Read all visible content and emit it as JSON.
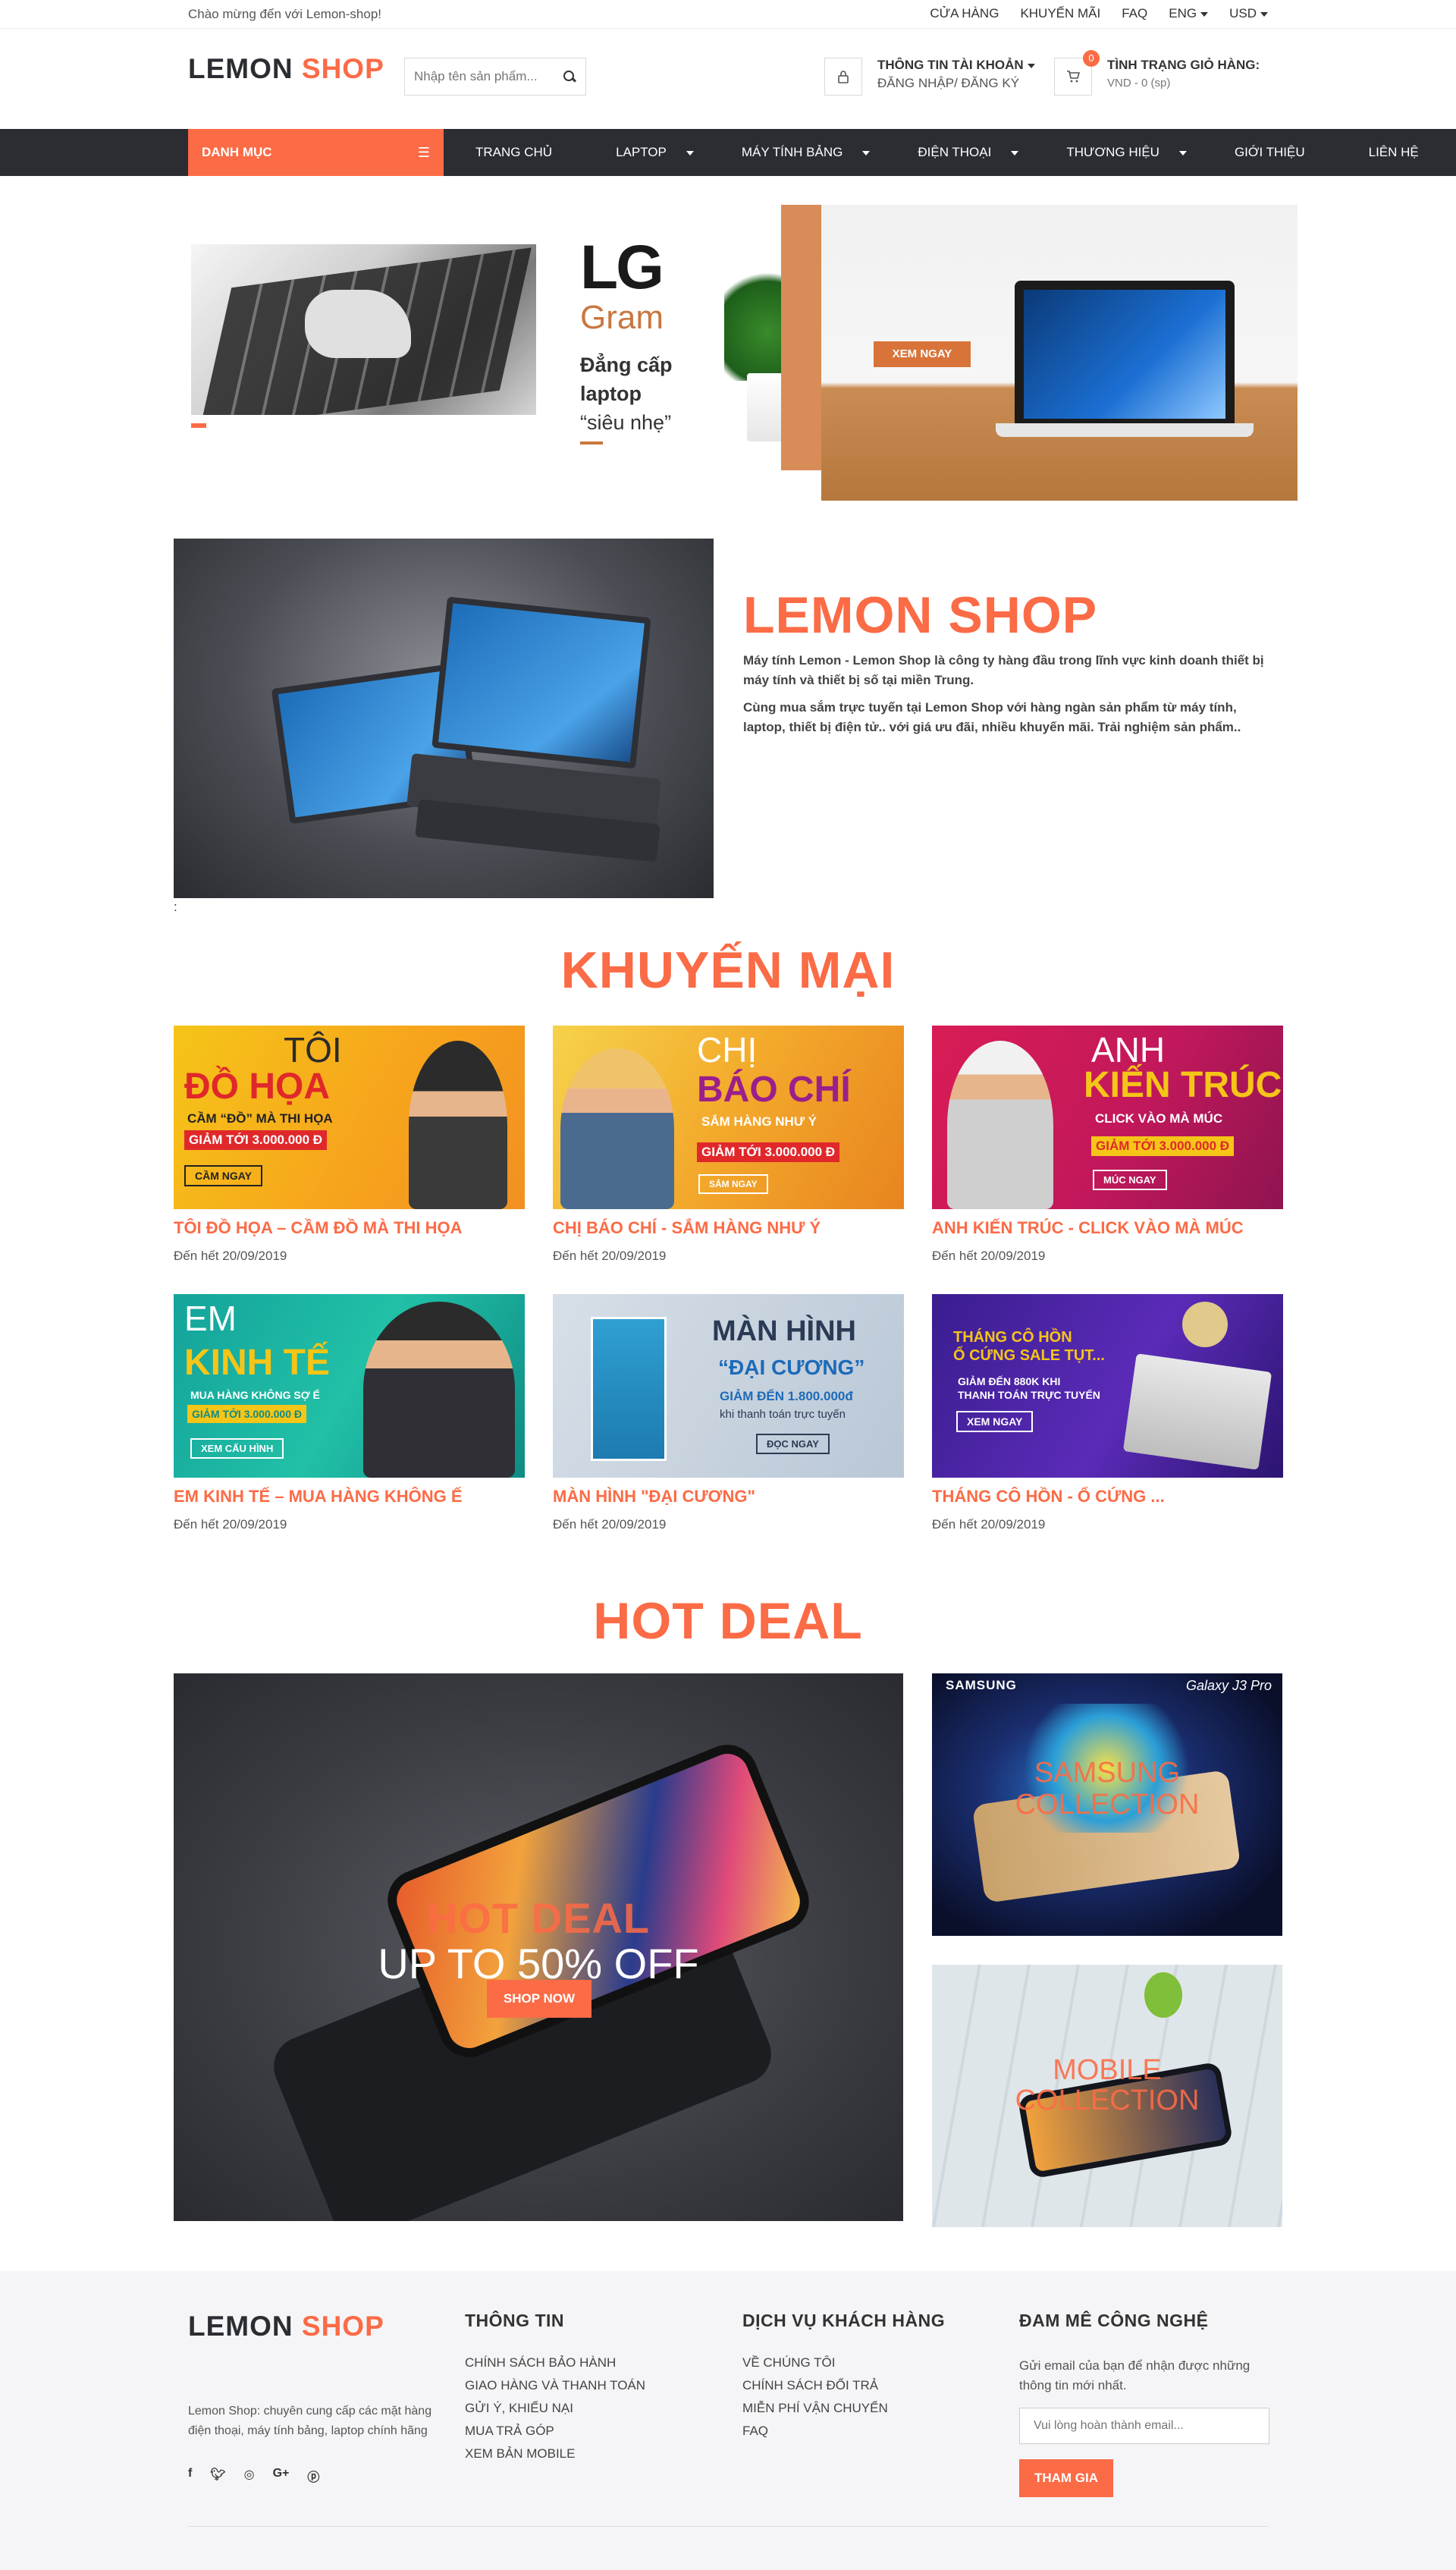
{
  "topbar": {
    "welcome": "Chào mừng đến với Lemon-shop!",
    "links": [
      "CỬA HÀNG",
      "KHUYẾN MÃI",
      "FAQ"
    ],
    "language": "ENG",
    "currency": "USD"
  },
  "header": {
    "logo_part1": "LEMON",
    "logo_part2": "SHOP",
    "search_placeholder": "Nhập tên sản phẩm...",
    "account_title": "THÔNG TIN TÀI KHOẢN",
    "account_sub": "ĐĂNG NHẬP/ ĐĂNG KÝ",
    "cart_title": "TÌNH TRẠNG GIỎ HÀNG:",
    "cart_sub": "VND - 0 (sp)",
    "cart_count": "0"
  },
  "nav": {
    "category_label": "DANH MỤC",
    "items": [
      {
        "label": "TRANG CHỦ",
        "dropdown": false
      },
      {
        "label": "LAPTOP",
        "dropdown": true
      },
      {
        "label": "MÁY TÍNH BẢNG",
        "dropdown": true
      },
      {
        "label": "ĐIỆN THOẠI",
        "dropdown": true
      },
      {
        "label": "THƯƠNG HIỆU",
        "dropdown": true
      },
      {
        "label": "GIỚI THIỆU",
        "dropdown": false
      },
      {
        "label": "LIÊN HỆ",
        "dropdown": false
      }
    ]
  },
  "hero": {
    "brand": "LG",
    "product": "Gram",
    "tagline1": "Đẳng cấp",
    "tagline2": "laptop",
    "tagline3": "“siêu nhẹ”",
    "cta": "XEM NGAY"
  },
  "about": {
    "title": "LEMON SHOP",
    "paragraph1": "Máy tính Lemon - Lemon Shop là công ty hàng đầu trong lĩnh vực kinh doanh thiết bị máy tính và thiết bị số tại miền Trung.",
    "paragraph2": "Cùng mua sắm trực tuyến tại Lemon Shop với hàng ngàn sản phẩm từ máy tính, laptop, thiết bị điện tử.. với giá ưu đãi, nhiều khuyến mãi. Trải nghiệm sản phẩm..",
    "trailing": ":"
  },
  "promotions": {
    "title": "KHUYẾN MẠI",
    "items": [
      {
        "title": "TÔI ĐỒ HỌA – CẦM ĐỒ MÀ THI HỌA",
        "date": "Đến hết 20/09/2019",
        "banner_line1": "TÔI",
        "banner_line2": "ĐỒ HỌA",
        "banner_sub": "CẦM “ĐỒ” MÀ THI HỌA",
        "banner_price": "GIẢM TỚI 3.000.000 Đ",
        "banner_btn": "CẦM NGAY"
      },
      {
        "title": "CHỊ BÁO CHÍ - SẮM HÀNG NHƯ Ý",
        "date": "Đến hết 20/09/2019",
        "banner_line1": "CHỊ",
        "banner_line2": "BÁO CHÍ",
        "banner_sub": "SẮM HÀNG NHƯ Ý",
        "banner_price": "GIẢM TỚI 3.000.000 Đ",
        "banner_btn": "SẮM NGAY"
      },
      {
        "title": "ANH KIẾN TRÚC - CLICK VÀO MÀ MÚC",
        "date": "Đến hết 20/09/2019",
        "banner_line1": "ANH",
        "banner_line2": "KIẾN TRÚC",
        "banner_sub": "CLICK VÀO MÀ MÚC",
        "banner_price": "GIẢM TỚI 3.000.000 Đ",
        "banner_btn": "MÚC NGAY"
      },
      {
        "title": "EM KINH TẾ – MUA HÀNG KHÔNG Ế",
        "date": "Đến hết 20/09/2019",
        "banner_line1": "EM",
        "banner_line2": "KINH TẾ",
        "banner_sub": "MUA HÀNG KHÔNG SỢ Ế",
        "banner_price": "GIẢM TỚI 3.000.000 Đ",
        "banner_btn": "XEM CẤU HÌNH"
      },
      {
        "title": "MÀN HÌNH \"ĐẠI CƯƠNG\"",
        "date": "Đến hết 20/09/2019",
        "banner_line1": "MÀN HÌNH",
        "banner_line2": "“ĐẠI CƯƠNG”",
        "banner_sub": "GIẢM ĐẾN 1.800.000đ",
        "banner_price": "khi thanh toán trực tuyến",
        "banner_btn": "ĐỌC NGAY"
      },
      {
        "title": "THÁNG CÔ HỒN - Ổ CỨNG ...",
        "date": "Đến hết 20/09/2019",
        "banner_line1": "THÁNG CÔ HỒN",
        "banner_line2": "Ổ CỨNG SALE TỤT...",
        "banner_sub": "GIẢM ĐẾN 880K KHI",
        "banner_price": "THANH TOÁN TRỰC TUYẾN",
        "banner_btn": "XEM NGAY"
      }
    ]
  },
  "hotdeal": {
    "title": "HOT DEAL",
    "main_line1": "HOT DEAL",
    "main_line2": "UP TO 50% OFF",
    "main_cta": "SHOP NOW",
    "samsung_brand": "SAMSUNG",
    "samsung_model": "Galaxy J3 Pro",
    "samsung_caption1": "SAMSUNG",
    "samsung_caption2": "COLLECTION",
    "mobile_caption1": "MOBILE",
    "mobile_caption2": "COLLECTION"
  },
  "footer": {
    "logo_part1": "LEMON",
    "logo_part2": "SHOP",
    "description": "Lemon Shop: chuyên cung cấp các mặt hàng điện thoại, máy tính bảng, laptop chính hãng",
    "info_title": "THÔNG TIN",
    "info_links": [
      "CHÍNH SÁCH BẢO HÀNH",
      "GIAO HÀNG VÀ THANH TOÁN",
      "GỬI Ý, KHIẾU NẠI",
      "MUA TRẢ GÓP",
      "XEM BẢN MOBILE"
    ],
    "service_title": "DỊCH VỤ KHÁCH HÀNG",
    "service_links": [
      "VỀ CHÚNG TÔI",
      "CHÍNH SÁCH ĐỔI TRẢ",
      "MIỄN PHÍ VẬN CHUYỂN",
      "FAQ"
    ],
    "newsletter_title": "ĐAM MÊ CÔNG NGHỆ",
    "newsletter_text": "Gửi email của bạn để nhận được những thông tin mới nhất.",
    "newsletter_placeholder": "Vui lòng hoàn thành email...",
    "newsletter_button": "THAM GIA"
  },
  "colors": {
    "accent": "#fb6b46",
    "dark": "#2b2d33"
  }
}
